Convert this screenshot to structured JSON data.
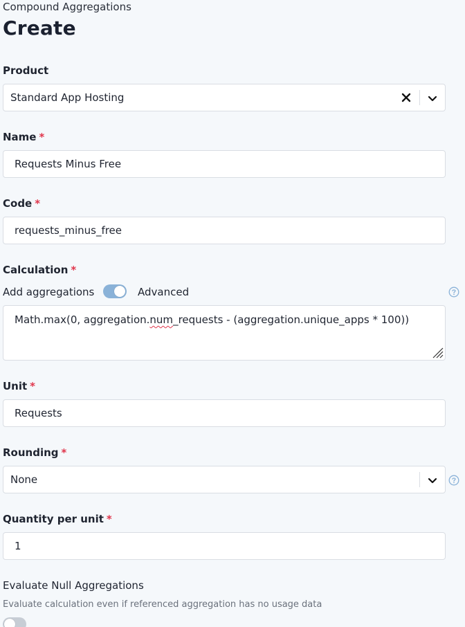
{
  "breadcrumb": "Compound Aggregations",
  "page_title": "Create",
  "product": {
    "label": "Product",
    "value": "Standard App Hosting",
    "clear_icon": "close-icon",
    "dropdown_icon": "chevron-down-icon"
  },
  "name": {
    "label": "Name",
    "required": "*",
    "value": "Requests Minus Free"
  },
  "code": {
    "label": "Code",
    "required": "*",
    "value": "requests_minus_free"
  },
  "calculation": {
    "label": "Calculation",
    "required": "*",
    "toggle_left_label": "Add aggregations",
    "toggle_right_label": "Advanced",
    "toggle_state": "on",
    "help_icon": "help-circle-icon",
    "expression_prefix": "Math.max(0, aggregation.",
    "expression_misspelled": "num",
    "expression_suffix": "_requests - (aggregation.unique_apps * 100))"
  },
  "unit": {
    "label": "Unit",
    "required": "*",
    "value": "Requests"
  },
  "rounding": {
    "label": "Rounding",
    "required": "*",
    "value": "None",
    "dropdown_icon": "chevron-down-icon",
    "help_icon": "help-circle-icon"
  },
  "quantity_per_unit": {
    "label": "Quantity per unit",
    "required": "*",
    "value": "1"
  },
  "evaluate_null": {
    "label": "Evaluate Null Aggregations",
    "hint": "Evaluate calculation even if referenced aggregation has no usage data",
    "toggle_state": "off"
  },
  "colors": {
    "background": "#f5f8fb",
    "required": "#e0364c",
    "toggle_on": "#8ab2d8",
    "toggle_off": "#c7cdd5",
    "help": "#8ab2d8"
  }
}
